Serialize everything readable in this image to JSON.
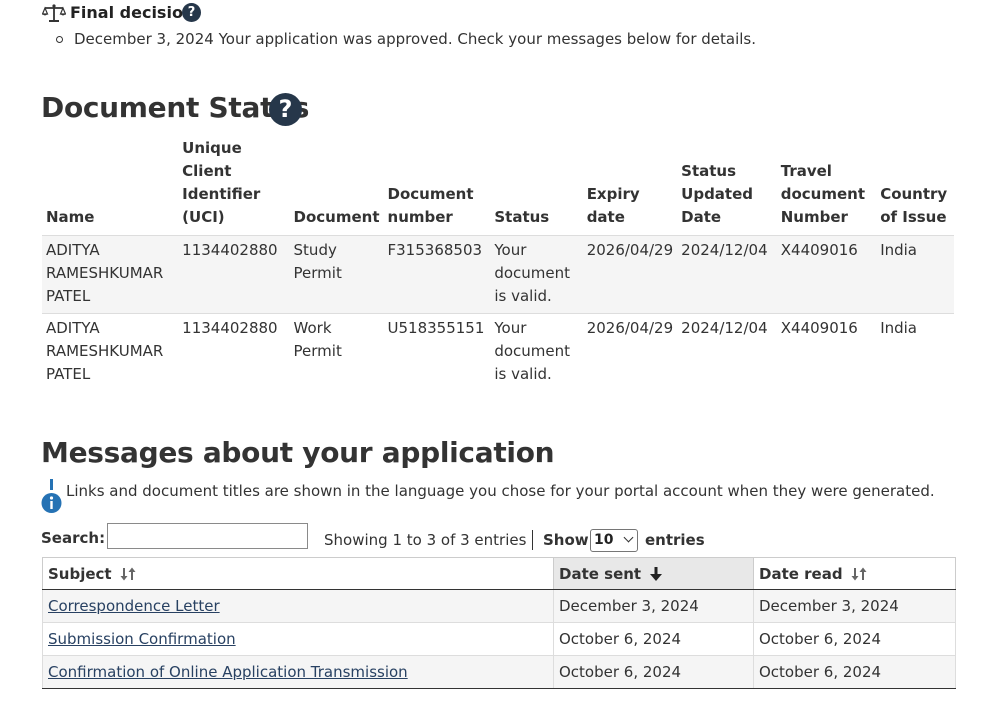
{
  "final_decision": {
    "title": "Final decision",
    "help_icon": "question-circle-icon",
    "items": [
      {
        "date": "December 3, 2024",
        "text": "Your application was approved. Check your messages below for details."
      }
    ]
  },
  "document_status": {
    "title": "Document Status",
    "headers": [
      "Name",
      "Unique Client Identifier (UCI)",
      "Document",
      "Document number",
      "Status",
      "Expiry date",
      "Status Updated Date",
      "Travel document Number",
      "Country of Issue"
    ],
    "rows": [
      [
        "ADITYA RAMESHKUMAR PATEL",
        "1134402880",
        "Study Permit",
        "F315368503",
        "Your document is valid.",
        "2026/04/29",
        "2024/12/04",
        "X4409016",
        "India"
      ],
      [
        "ADITYA RAMESHKUMAR PATEL",
        "1134402880",
        "Work Permit",
        "U518355151",
        "Your document is valid.",
        "2026/04/29",
        "2024/12/04",
        "X4409016",
        "India"
      ]
    ]
  },
  "messages": {
    "title": "Messages about your application",
    "info_icon": "info-icon",
    "info_text": "Links and document titles are shown in the language you chose for your portal account when they were generated.",
    "search_label": "Search:",
    "search_value": "",
    "showing_text": "Showing 1 to 3 of 3 entries",
    "show_label": "Show",
    "length_value": "10",
    "entries_label": "entries",
    "columns": [
      "Subject",
      "Date sent",
      "Date read"
    ],
    "rows": [
      [
        "Correspondence Letter",
        "December 3, 2024",
        "December 3, 2024"
      ],
      [
        "Submission Confirmation",
        "October 6, 2024",
        "October 6, 2024"
      ],
      [
        "Confirmation of Online Application Transmission",
        "October 6, 2024",
        "October 6, 2024"
      ]
    ]
  },
  "colors": {
    "heading": "#333333",
    "help_icon_bg": "#26374a",
    "link": "#284162",
    "info": "#2572b4"
  }
}
